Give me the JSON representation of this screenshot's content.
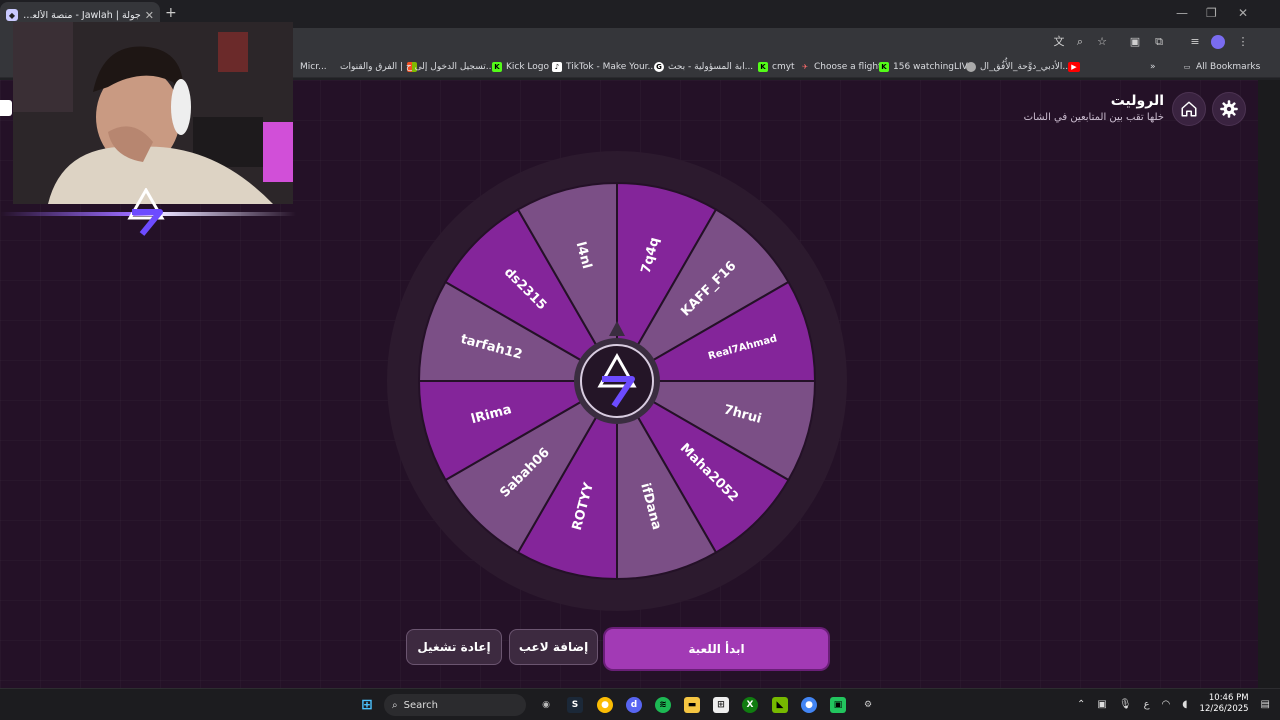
{
  "browser": {
    "tab_title": "جولة | Jawlah - منصة الألعاب الـ",
    "new_tab": "+",
    "window_controls": [
      "—",
      "❐",
      "✕"
    ],
    "bookmarks": [
      {
        "label": "Micr...",
        "icon": "folder-icon",
        "color": "#dadce0"
      },
      {
        "label": "الفرق والقنوات |",
        "icon": "microsoft-icon",
        "color": "#f25022"
      },
      {
        "label": "تسجيل الدخول إلى ح...",
        "icon": "microsoft-icon",
        "color": "#7fba00"
      },
      {
        "label": "Kick Logo",
        "icon": "kick-icon",
        "color": "#53fc18"
      },
      {
        "label": "TikTok - Make Your...",
        "icon": "tiktok-icon",
        "color": "#ffffff"
      },
      {
        "label": "ابة المسؤولية - بحث...",
        "icon": "google-icon",
        "color": "#ffffff"
      },
      {
        "label": "cmyt",
        "icon": "kick-icon",
        "color": "#53fc18"
      },
      {
        "label": "Choose a flight",
        "icon": "plane-icon",
        "color": "#ff6b6b"
      },
      {
        "label": "156 watchingLIVE",
        "icon": "kick-icon",
        "color": "#53fc18"
      },
      {
        "label": "الأدبي_دوَّحة_الأُفُق_ال...",
        "icon": "globe-icon",
        "color": "#cccccc"
      },
      {
        "label": "",
        "icon": "youtube-icon",
        "color": "#ff0000"
      }
    ],
    "all_bookmarks": "All Bookmarks"
  },
  "header": {
    "title": "الروليت",
    "subtitle": "خلها تقب بين المتابعين في الشات"
  },
  "wheel": {
    "players": [
      "7q4q",
      "KAFF_F16",
      "Real7Ahmad",
      "7hrui",
      "Maha2052",
      "ifDana",
      "ROTYY",
      "Sabah06",
      "lRima",
      "tarfah12",
      "ds2315",
      "l4nl"
    ],
    "colors": {
      "dark": "#84259a",
      "light": "#7b4f86",
      "rim": "#2c1a2e",
      "hub": "#3a2d40"
    }
  },
  "buttons": {
    "start": "ابدأ اللعبة",
    "add_player": "إضافة لاعب",
    "restart": "إعادة تشغيل"
  },
  "taskbar": {
    "search": "Search",
    "lang": "ع",
    "time": "10:46 PM",
    "date": "12/26/2025"
  }
}
